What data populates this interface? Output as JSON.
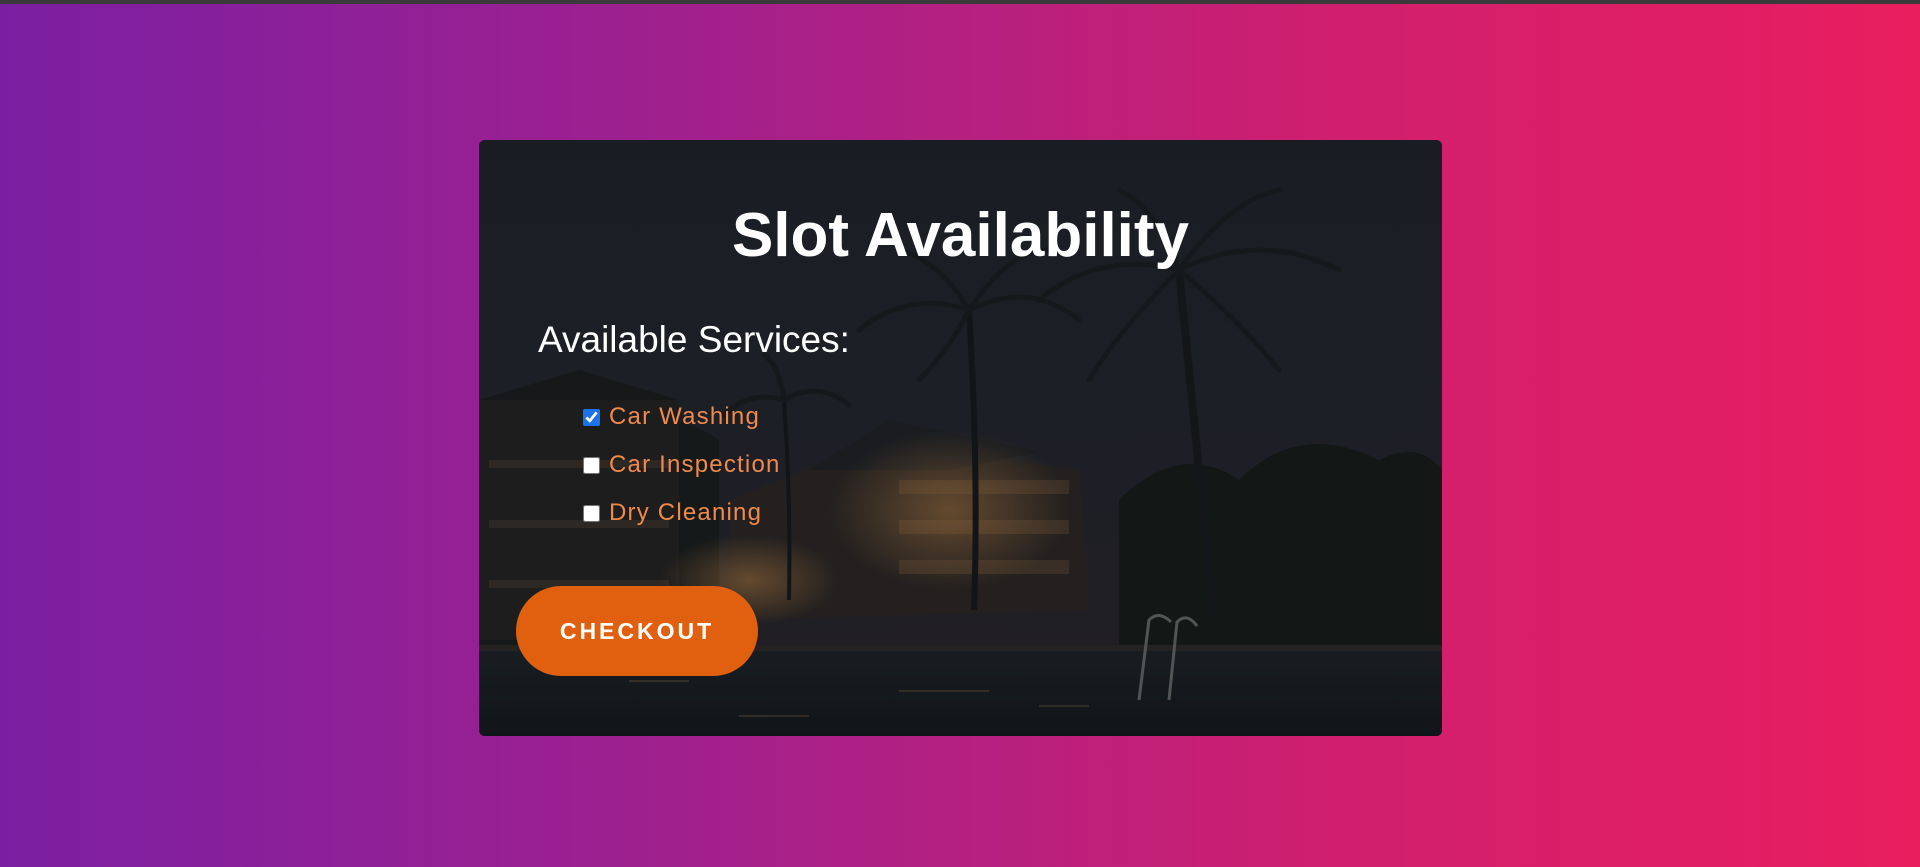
{
  "page": {
    "accent_color": "#e0600f",
    "service_text_color": "#f08a4b",
    "gradient_start": "#7b1fa2",
    "gradient_end": "#e91e5f"
  },
  "card": {
    "title": "Slot Availability",
    "background_image": "night-resort-palm-trees-pool",
    "services_heading": "Available Services:",
    "services": [
      {
        "label": "Car Washing",
        "checked": true
      },
      {
        "label": "Car Inspection",
        "checked": false
      },
      {
        "label": "Dry Cleaning",
        "checked": false
      }
    ],
    "checkout_label": "CHECKOUT"
  }
}
